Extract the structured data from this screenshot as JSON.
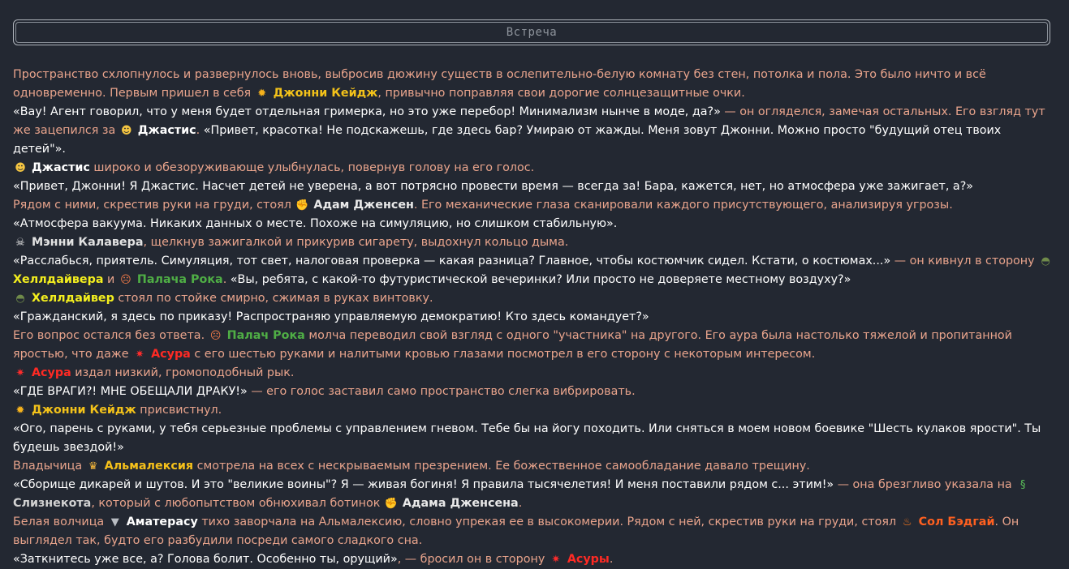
{
  "title": "Встреча",
  "colors": {
    "background": "#232832",
    "narration": "#e9a48c",
    "speech": "#ffffff",
    "johnny": "#f3c21a",
    "helldiver": "#f4ef1e",
    "executioner": "#4fae45",
    "asura": "#ff2a24",
    "almalexia": "#f6c11a",
    "sol": "#ff6020"
  },
  "icons": {
    "johnny": "sun-icon",
    "justice": "sunglasses-face-icon",
    "adam": "muscle-arm-icon",
    "manny": "skull-icon",
    "helldiver": "military-helmet-icon",
    "executioner": "angry-face-icon",
    "asura": "burst-icon",
    "almalexia": "crown-icon",
    "snake": "lizard-icon",
    "amaterasu": "wolf-icon",
    "sol": "fire-icon"
  },
  "t": {
    "l1a": "Пространство схлопнулось и развернулось вновь, выбросив дюжину существ в ослепительно-белую комнату без стен, потолка и пола. Это было ничто и всё одновременно. Первым пришел в себя ",
    "l1b": ", привычно поправляя свои дорогие солнцезащитные очки.",
    "l2a": "«Вау! Агент говорил, что у меня будет отдельная гримерка, но это уже перебор! Минимализм нынче в моде, да?»",
    "l2b": " — он огляделся, замечая остальных. Его взгляд тут же зацепился за ",
    "l2c": ". ",
    "l2d": "«Привет, красотка! Не подскажешь, где здесь бар? Умираю от жажды. Меня зовут Джонни. Можно просто \"будущий отец твоих детей\"».",
    "l3": " широко и обезоруживающе улыбнулась, повернув голову на его голос.",
    "l4": "«Привет, Джонни! Я Джастис. Насчет детей не уверена, а вот потрясно провести время — всегда за! Бара, кажется, нет, но атмосфера уже зажигает, а?»",
    "l5a": "Рядом с ними, скрестив руки на груди, стоял ",
    "l5b": ". Его механические глаза сканировали каждого присутствующего, анализируя угрозы.",
    "l6": "«Атмосфера вакуума. Никаких данных о месте. Похоже на симуляцию, но слишком стабильную».",
    "l7": ", щелкнув зажигалкой и прикурив сигарету, выдохнул кольцо дыма.",
    "l8a": "«Расслабься, приятель. Симуляция, тот свет, налоговая проверка — какая разница? Главное, чтобы костюмчик сидел. Кстати, о костюмах...»",
    "l8b": " — он кивнул в сторону ",
    "l8c": " и ",
    "l8d": ". ",
    "l8e": "«Вы, ребята, с какой-то футуристической вечеринки? Или просто не доверяете местному воздуху?»",
    "l9": " стоял по стойке смирно, сжимая в руках винтовку.",
    "l10": "«Гражданский, я здесь по приказу! Распространяю управляемую демократию! Кто здесь командует?»",
    "l11a": "Его вопрос остался без ответа. ",
    "l11b": " молча переводил свой взгляд с одного \"участника\" на другого. Его аура была настолько тяжелой и пропитанной яростью, что даже ",
    "l11c": " с его шестью руками и налитыми кровью глазами посмотрел в его сторону с некоторым интересом.",
    "l12": " издал низкий, громоподобный рык.",
    "l13a": "«ГДЕ ВРАГИ?! МНЕ ОБЕЩАЛИ ДРАКУ!»",
    "l13b": " — его голос заставил само пространство слегка вибрировать.",
    "l14": " присвистнул.",
    "l15": "«Ого, парень с руками, у тебя серьезные проблемы с управлением гневом. Тебе бы на йогу походить. Или сняться в моем новом боевике \"Шесть кулаков ярости\". Ты будешь звездой!»",
    "l16a": "Владычица ",
    "l16b": " смотрела на всех с нескрываемым презрением. Ее божественное самообладание давало трещину.",
    "l17a": "«Сборище дикарей и шутов. И это \"великие воины\"? Я — живая богиня! Я правила тысячелетия! И меня поставили рядом с... этим!»",
    "l17b": " — она брезгливо указала на ",
    "l17c": ", который с любопытством обнюхивал ботинок ",
    "l17d": ".",
    "l18a": "Белая волчица ",
    "l18b": " тихо заворчала на Альмалексию, словно упрекая ее в высокомерии. Рядом с ней, скрестив руки на груди, стоял ",
    "l18c": ". Он выглядел так, будто его разбудили посреди самого сладкого сна.",
    "l19a": "«Заткнитесь уже все, а? Голова болит. Особенно ты, орущий»",
    "l19b": ", — бросил он в сторону ",
    "l19c": "."
  },
  "names": {
    "johnny_nom": "Джонни Кейдж",
    "justice_acc": "Джастис",
    "justice_nom": "Джастис",
    "adam_nom": "Адам Дженсен",
    "manny_nom": "Мэнни Калавера",
    "helldiver_gen": "Хеллдайвера",
    "executioner_gen": "Палача Рока",
    "helldiver_nom": "Хеллдайвер",
    "executioner_nom": "Палач Рока",
    "asura_nom": "Асура",
    "almalexia_nom": "Альмалексия",
    "snake_nom": "Слизнекота",
    "adam_gen": "Адама Дженсена",
    "amaterasu_nom": "Аматерасу",
    "sol_nom": "Сол Бэдгай",
    "asura_gen": "Асуры"
  }
}
